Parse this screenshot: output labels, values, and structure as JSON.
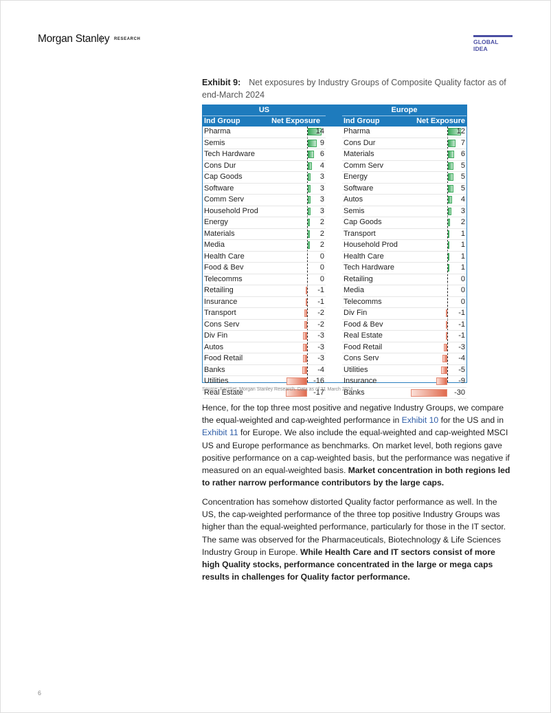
{
  "header": {
    "brand": "Morgan Stanley",
    "section": "RESEARCH",
    "tag": "GLOBAL IDEA",
    "tag_color": "#4a4ea3"
  },
  "exhibit": {
    "label": "Exhibit 9:",
    "title": "Net exposures by Industry Groups of Composite Quality factor as of end-March 2024",
    "source": "Source: FactSet, Morgan Stanley Research. Data as of 31 March 2024."
  },
  "chart_data": {
    "type": "table",
    "title": "Net exposures by Industry Groups of Composite Quality factor as of end-March 2024",
    "header_color": "#1e7bbd",
    "positive_color": "#3daa5c",
    "negative_color": "#e06a4e",
    "tables": [
      {
        "region": "US",
        "columns": [
          "Ind Group",
          "Net Exposure"
        ],
        "rows": [
          {
            "group": "Pharma",
            "value": 14
          },
          {
            "group": "Semis",
            "value": 9
          },
          {
            "group": "Tech Hardware",
            "value": 6
          },
          {
            "group": "Cons Dur",
            "value": 4
          },
          {
            "group": "Cap Goods",
            "value": 3
          },
          {
            "group": "Software",
            "value": 3
          },
          {
            "group": "Comm Serv",
            "value": 3
          },
          {
            "group": "Household Prod",
            "value": 3
          },
          {
            "group": "Energy",
            "value": 2
          },
          {
            "group": "Materials",
            "value": 2
          },
          {
            "group": "Media",
            "value": 2
          },
          {
            "group": "Health Care",
            "value": 0
          },
          {
            "group": "Food & Bev",
            "value": 0
          },
          {
            "group": "Telecomms",
            "value": 0
          },
          {
            "group": "Retailing",
            "value": -1
          },
          {
            "group": "Insurance",
            "value": -1
          },
          {
            "group": "Transport",
            "value": -2
          },
          {
            "group": "Cons Serv",
            "value": -2
          },
          {
            "group": "Div Fin",
            "value": -3
          },
          {
            "group": "Autos",
            "value": -3
          },
          {
            "group": "Food Retail",
            "value": -3
          },
          {
            "group": "Banks",
            "value": -4
          },
          {
            "group": "Utilities",
            "value": -16
          },
          {
            "group": "Real Estate",
            "value": -17
          }
        ]
      },
      {
        "region": "Europe",
        "columns": [
          "Ind Group",
          "Net Exposure"
        ],
        "rows": [
          {
            "group": "Pharma",
            "value": 12
          },
          {
            "group": "Cons Dur",
            "value": 7
          },
          {
            "group": "Materials",
            "value": 6
          },
          {
            "group": "Comm Serv",
            "value": 5
          },
          {
            "group": "Energy",
            "value": 5
          },
          {
            "group": "Software",
            "value": 5
          },
          {
            "group": "Autos",
            "value": 4
          },
          {
            "group": "Semis",
            "value": 3
          },
          {
            "group": "Cap Goods",
            "value": 2
          },
          {
            "group": "Transport",
            "value": 1
          },
          {
            "group": "Household Prod",
            "value": 1
          },
          {
            "group": "Health Care",
            "value": 1
          },
          {
            "group": "Tech Hardware",
            "value": 1
          },
          {
            "group": "Retailing",
            "value": 0
          },
          {
            "group": "Media",
            "value": 0
          },
          {
            "group": "Telecomms",
            "value": 0
          },
          {
            "group": "Div Fin",
            "value": -1
          },
          {
            "group": "Food & Bev",
            "value": -1
          },
          {
            "group": "Real Estate",
            "value": -1
          },
          {
            "group": "Food Retail",
            "value": -3
          },
          {
            "group": "Cons Serv",
            "value": -4
          },
          {
            "group": "Utilities",
            "value": -5
          },
          {
            "group": "Insurance",
            "value": -9
          },
          {
            "group": "Banks",
            "value": -30
          }
        ]
      }
    ]
  },
  "body": {
    "p1": {
      "t1": "Hence, for the top three most positive and negative Industry Groups, we compare the equal-weighted and cap-weighted performance in ",
      "link1": "Exhibit 10",
      "t2": " for the US and in ",
      "link2": "Exhibit 11",
      "t3": " for Europe. We also include the equal-weighted and cap-weighted MSCI US and Europe performance as benchmarks. On market level, both regions gave positive performance on a cap-weighted basis, but the performance was negative if measured on an equal-weighted basis. ",
      "bold": "Market concentration in both regions led to rather narrow performance contributors by the large caps."
    },
    "p2": {
      "t1": "Concentration has somehow distorted Quality factor performance as well. In the US, the cap-weighted performance of the three top positive Industry Groups was higher than the equal-weighted performance, particularly for those in the IT sector. The same was observed for the Pharmaceuticals, Biotechnology & Life Sciences Industry Group in Europe. ",
      "bold": "While Health Care and IT sectors consist of more high Quality stocks, performance concentrated in the large or mega caps results in challenges for Quality factor performance."
    }
  },
  "footer": {
    "page_number": "6"
  }
}
